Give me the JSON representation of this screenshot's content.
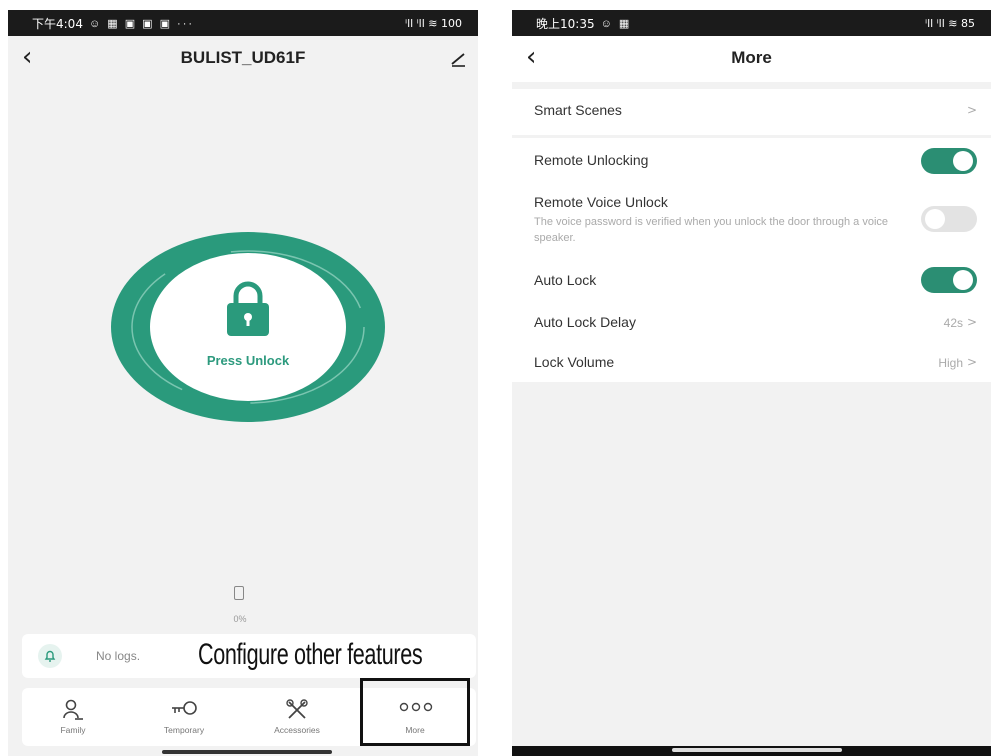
{
  "left": {
    "status_time": "下午4:04",
    "status_icons": "☺ ▦ ▣ ▣ ▣ ···",
    "status_right": "ⁱll ⁱll ≋ 100",
    "title": "BULIST_UD61F",
    "lock_label": "Press Unlock",
    "battery_pct": "0%",
    "logs_text": "No logs.",
    "caption": "Configure other features",
    "nav": [
      {
        "label": "Family"
      },
      {
        "label": "Temporary"
      },
      {
        "label": "Accessories"
      },
      {
        "label": "More"
      }
    ],
    "accent": "#2a9a7c"
  },
  "right": {
    "status_time": "晚上10:35",
    "status_icons": "☺ ▦",
    "status_right": "ⁱll ⁱll ≋ 85",
    "title": "More",
    "rows": {
      "smart_scenes": "Smart Scenes",
      "remote_unlocking": "Remote Unlocking",
      "remote_voice": "Remote Voice Unlock",
      "remote_voice_desc": "The voice password is verified when you unlock the door through a voice speaker.",
      "auto_lock": "Auto Lock",
      "auto_lock_delay": "Auto Lock Delay",
      "auto_lock_delay_value": "42s",
      "lock_volume": "Lock Volume",
      "lock_volume_value": "High"
    },
    "toggles": {
      "remote_unlocking": true,
      "remote_voice": false,
      "auto_lock": true
    },
    "accent": "#2b8e73"
  }
}
